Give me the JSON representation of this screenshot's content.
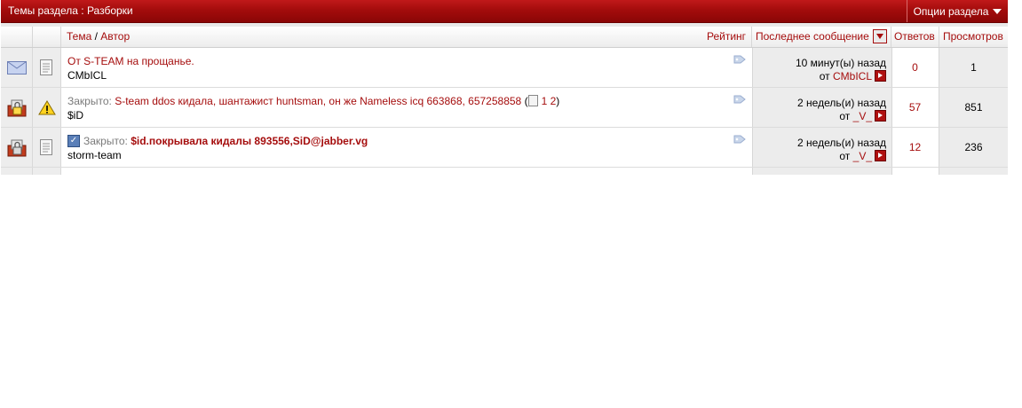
{
  "titlebar": {
    "title": "Темы раздела : Разборки",
    "options_label": "Опции раздела"
  },
  "header": {
    "topic_label": "Тема",
    "separator": "/",
    "author_label": "Автор",
    "rating_label": "Рейтинг",
    "last_post_label": "Последнее сообщение",
    "replies_label": "Ответов",
    "views_label": "Просмотров"
  },
  "threads": [
    {
      "title": "От S-TEAM на прощанье.",
      "author": "CMbICL",
      "last_time": "10 минут(ы) назад",
      "last_prefix": "от",
      "last_user": "CMbICL",
      "replies": "0",
      "views": "1"
    },
    {
      "closed_label": "Закрыто:",
      "title": "S-team ddos кидала, шантажист huntsman, он же Nameless icq 663868, 657258858",
      "pages_open": "(",
      "page1": "1",
      "page2": "2",
      "pages_close": ")",
      "author": "$iD",
      "last_time": "2 недель(и) назад",
      "last_prefix": "от",
      "last_user": "_V_",
      "replies": "57",
      "views": "851"
    },
    {
      "closed_label": "Закрыто:",
      "title": "$id.покрывала кидалы 893556,SiD@jabber.vg",
      "author": "storm-team",
      "last_time": "2 недель(и) назад",
      "last_prefix": "от",
      "last_user": "_V_",
      "replies": "12",
      "views": "236"
    }
  ],
  "colors": {
    "accent": "#a50d0d",
    "bar": "#a30c0c"
  }
}
